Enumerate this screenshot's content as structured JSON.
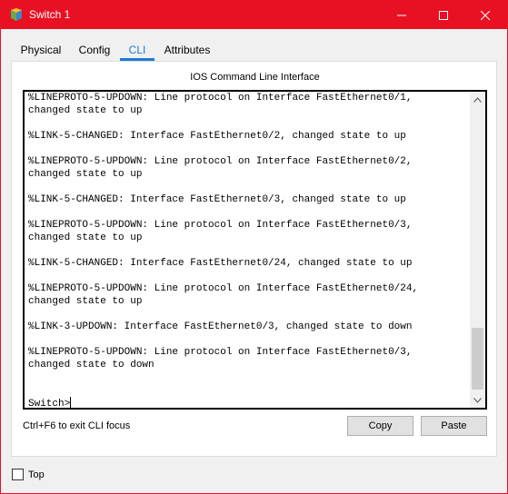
{
  "window": {
    "title": "Switch 1"
  },
  "tabs": [
    {
      "label": "Physical"
    },
    {
      "label": "Config"
    },
    {
      "label": "CLI"
    },
    {
      "label": "Attributes"
    }
  ],
  "active_tab": "CLI",
  "panel": {
    "heading": "IOS Command Line Interface"
  },
  "terminal": {
    "lines": [
      "%LINEPROTO-5-UPDOWN: Line protocol on Interface FastEthernet0/1,",
      "changed state to up",
      "",
      "%LINK-5-CHANGED: Interface FastEthernet0/2, changed state to up",
      "",
      "%LINEPROTO-5-UPDOWN: Line protocol on Interface FastEthernet0/2,",
      "changed state to up",
      "",
      "%LINK-5-CHANGED: Interface FastEthernet0/3, changed state to up",
      "",
      "%LINEPROTO-5-UPDOWN: Line protocol on Interface FastEthernet0/3,",
      "changed state to up",
      "",
      "%LINK-5-CHANGED: Interface FastEthernet0/24, changed state to up",
      "",
      "%LINEPROTO-5-UPDOWN: Line protocol on Interface FastEthernet0/24,",
      "changed state to up",
      "",
      "%LINK-3-UPDOWN: Interface FastEthernet0/3, changed state to down",
      "",
      "%LINEPROTO-5-UPDOWN: Line protocol on Interface FastEthernet0/3,",
      "changed state to down",
      "",
      "",
      "Switch>"
    ]
  },
  "footer": {
    "hint": "Ctrl+F6 to exit CLI focus",
    "copy_label": "Copy",
    "paste_label": "Paste"
  },
  "top_checkbox": {
    "label": "Top",
    "checked": false
  },
  "colors": {
    "titlebar": "#e81123",
    "active_tab": "#1e7bd8"
  },
  "icons": {
    "app": "switch-app-icon",
    "minimize": "minimize-icon",
    "maximize": "maximize-icon",
    "close": "close-icon",
    "scroll_up": "chevron-up-icon",
    "scroll_down": "chevron-down-icon"
  }
}
